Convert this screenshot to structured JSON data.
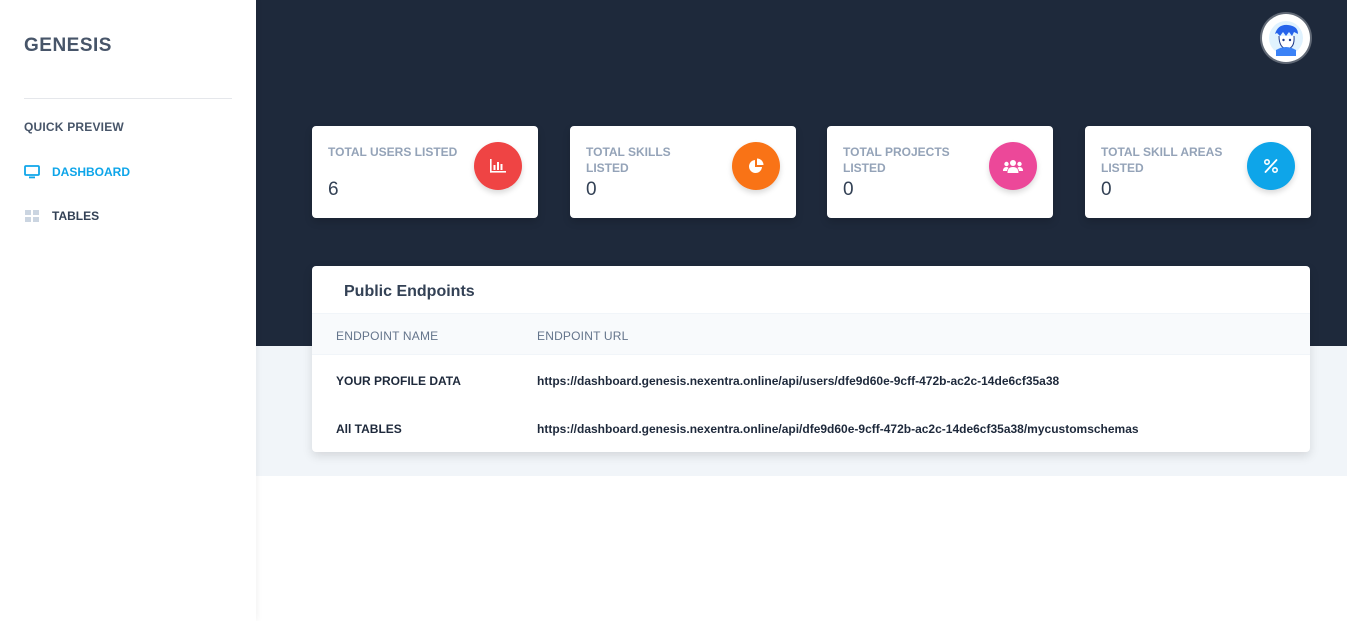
{
  "sidebar": {
    "brand": "GENESIS",
    "section_title": "QUICK PREVIEW",
    "items": [
      {
        "label": "DASHBOARD",
        "icon": "monitor-icon",
        "active": true
      },
      {
        "label": "TABLES",
        "icon": "table-icon",
        "active": false
      }
    ]
  },
  "header": {
    "avatar_icon": "user-avatar"
  },
  "stats": [
    {
      "label": "TOTAL USERS LISTED",
      "value": "6",
      "icon": "bar-chart-icon",
      "color": "#ef4444"
    },
    {
      "label": "TOTAL SKILLS LISTED",
      "value": "0",
      "icon": "pie-chart-icon",
      "color": "#f97316"
    },
    {
      "label": "TOTAL PROJECTS LISTED",
      "value": "0",
      "icon": "users-icon",
      "color": "#ec4899"
    },
    {
      "label": "TOTAL SKILL AREAS LISTED",
      "value": "0",
      "icon": "percent-icon",
      "color": "#0ea5e9"
    }
  ],
  "endpoints": {
    "title": "Public Endpoints",
    "columns": [
      "ENDPOINT NAME",
      "ENDPOINT URL"
    ],
    "rows": [
      {
        "name": "YOUR PROFILE DATA",
        "url": "https://dashboard.genesis.nexentra.online/api/users/dfe9d60e-9cff-472b-ac2c-14de6cf35a38"
      },
      {
        "name": "All TABLES",
        "url": "https://dashboard.genesis.nexentra.online/api/dfe9d60e-9cff-472b-ac2c-14de6cf35a38/mycustomschemas"
      }
    ]
  },
  "colors": {
    "header_bg": "#1e293b",
    "accent": "#0ea5e9"
  }
}
